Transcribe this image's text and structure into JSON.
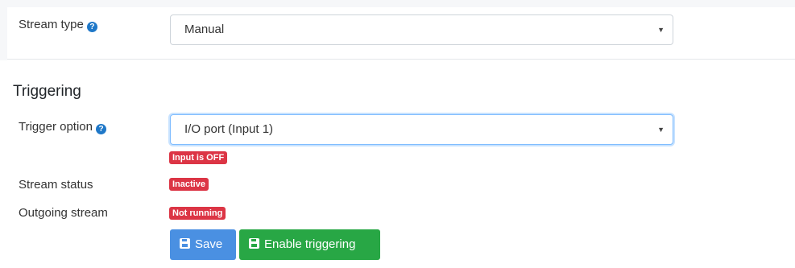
{
  "stream_type": {
    "label": "Stream type",
    "value": "Manual"
  },
  "triggering": {
    "heading": "Triggering",
    "trigger_option": {
      "label": "Trigger option",
      "value": "I/O port (Input 1)",
      "status_badge": "Input is OFF"
    },
    "stream_status": {
      "label": "Stream status",
      "badge": "Inactive"
    },
    "outgoing_stream": {
      "label": "Outgoing stream",
      "badge": "Not running"
    }
  },
  "actions": {
    "save_label": "Save",
    "enable_label": "Enable triggering"
  },
  "icons": {
    "help": "question-circle-icon",
    "save": "floppy-disk-icon",
    "dropdown": "caret-down-icon"
  },
  "colors": {
    "help_icon": "#1f78c8",
    "badge_danger": "#dc3545",
    "save_button": "#4a90e2",
    "enable_button": "#28a745",
    "focus_border": "#80bdff"
  }
}
